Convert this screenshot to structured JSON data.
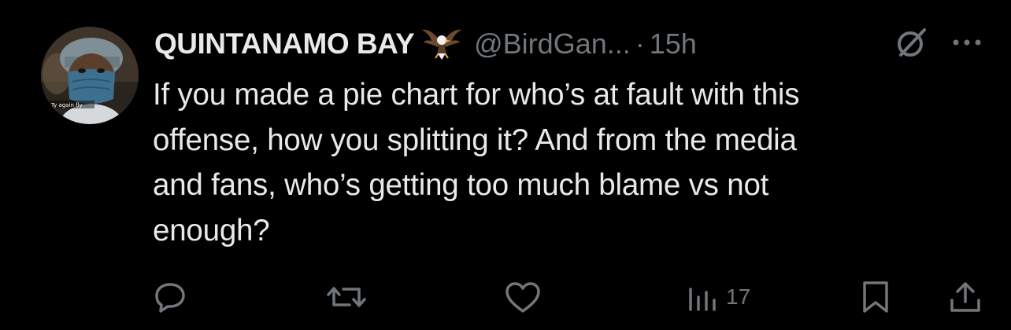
{
  "tweet": {
    "display_name": "QUINTANAMO BAY",
    "handle": "@BirdGan...",
    "separator": "·",
    "time": "15h",
    "text": "If you made a pie chart for who’s at fault with this\noffense, how you splitting it? And from the media\nand fans, who’s getting too much blame vs not\nenough?",
    "badge_icon": "eagle-emoji",
    "avatar_caption": "Ty again fly"
  },
  "actions": {
    "reply_icon": "reply-icon",
    "retweet_icon": "retweet-icon",
    "like_icon": "heart-icon",
    "views_icon": "views-bar-chart-icon",
    "views": "17",
    "bookmark_icon": "bookmark-icon",
    "share_icon": "share-icon"
  },
  "colors": {
    "background": "#000000",
    "primary_text": "#e7e9ea",
    "secondary_text": "#71767b"
  }
}
